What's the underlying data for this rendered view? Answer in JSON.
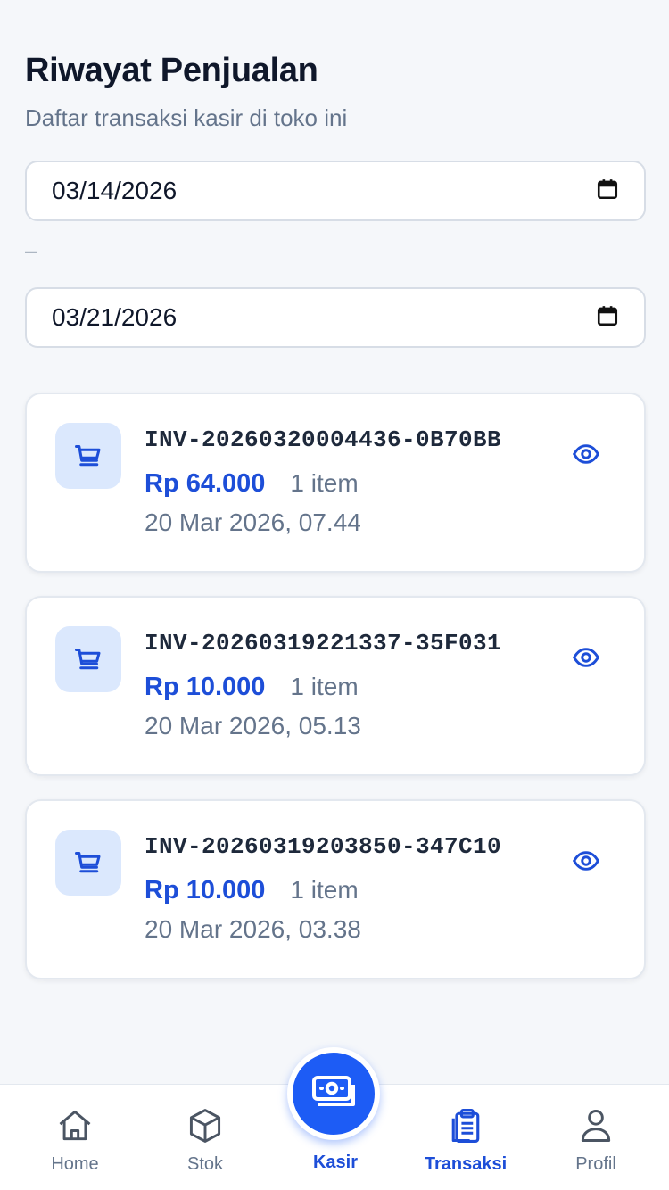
{
  "header": {
    "title": "Riwayat Penjualan",
    "subtitle": "Daftar transaksi kasir di toko ini"
  },
  "filter": {
    "date_from": "03/14/2026",
    "separator": "–",
    "date_to": "03/21/2026",
    "calendar_icon": "calendar-icon"
  },
  "transactions": [
    {
      "invoice": "INV-20260320004436-0B70BB",
      "amount": "Rp 64.000",
      "items": "1 item",
      "datetime": "20 Mar 2026, 07.44"
    },
    {
      "invoice": "INV-20260319221337-35F031",
      "amount": "Rp 10.000",
      "items": "1 item",
      "datetime": "20 Mar 2026, 05.13"
    },
    {
      "invoice": "INV-20260319203850-347C10",
      "amount": "Rp 10.000",
      "items": "1 item",
      "datetime": "20 Mar 2026, 03.38"
    }
  ],
  "bottom_nav": {
    "home": "Home",
    "stok": "Stok",
    "kasir": "Kasir",
    "transaksi": "Transaksi",
    "profil": "Profil",
    "active": "transaksi"
  },
  "colors": {
    "accent": "#1d4ed8",
    "fab": "#1d5cf5",
    "icon_bg": "#dbe8fd",
    "muted": "#64748b"
  }
}
